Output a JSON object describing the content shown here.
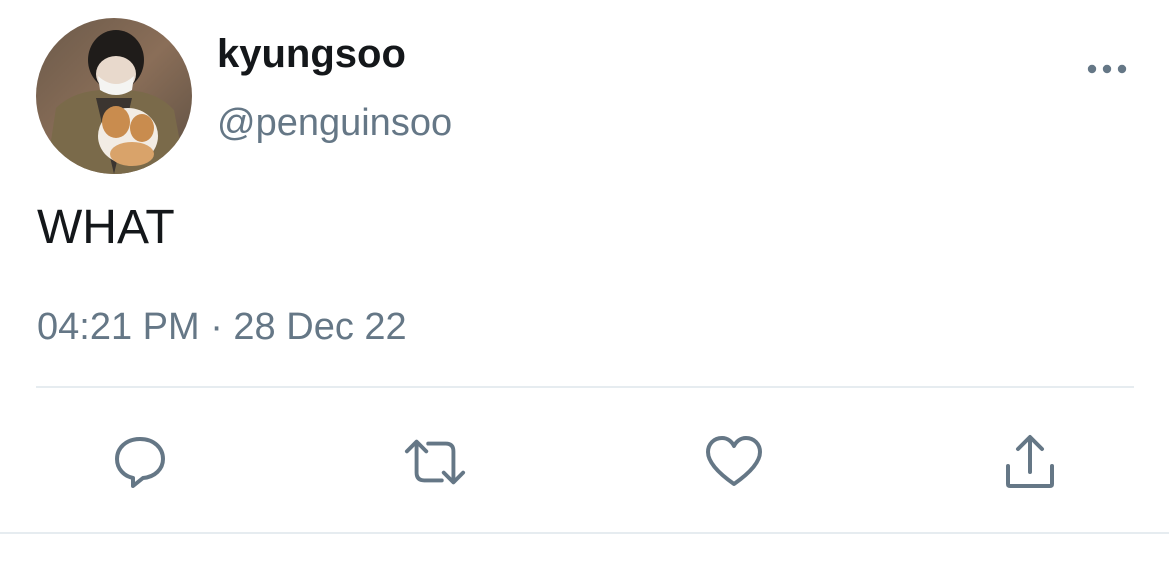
{
  "tweet": {
    "author": {
      "display_name": "kyungsoo",
      "handle": "@penguinsoo",
      "avatar_icon": "user-avatar-photo"
    },
    "text": "WHAT",
    "timestamp": "04:21 PM · 28 Dec 22",
    "more_icon": "ellipsis-icon"
  },
  "actions": [
    {
      "name": "reply",
      "icon": "speech-bubble-icon"
    },
    {
      "name": "retweet",
      "icon": "retweet-arrows-icon"
    },
    {
      "name": "like",
      "icon": "heart-icon"
    },
    {
      "name": "share",
      "icon": "share-upload-icon"
    }
  ],
  "colors": {
    "text_primary": "#14171a",
    "text_secondary": "#657786",
    "icon": "#657786",
    "divider": "#e6ecf0",
    "background": "#ffffff"
  }
}
